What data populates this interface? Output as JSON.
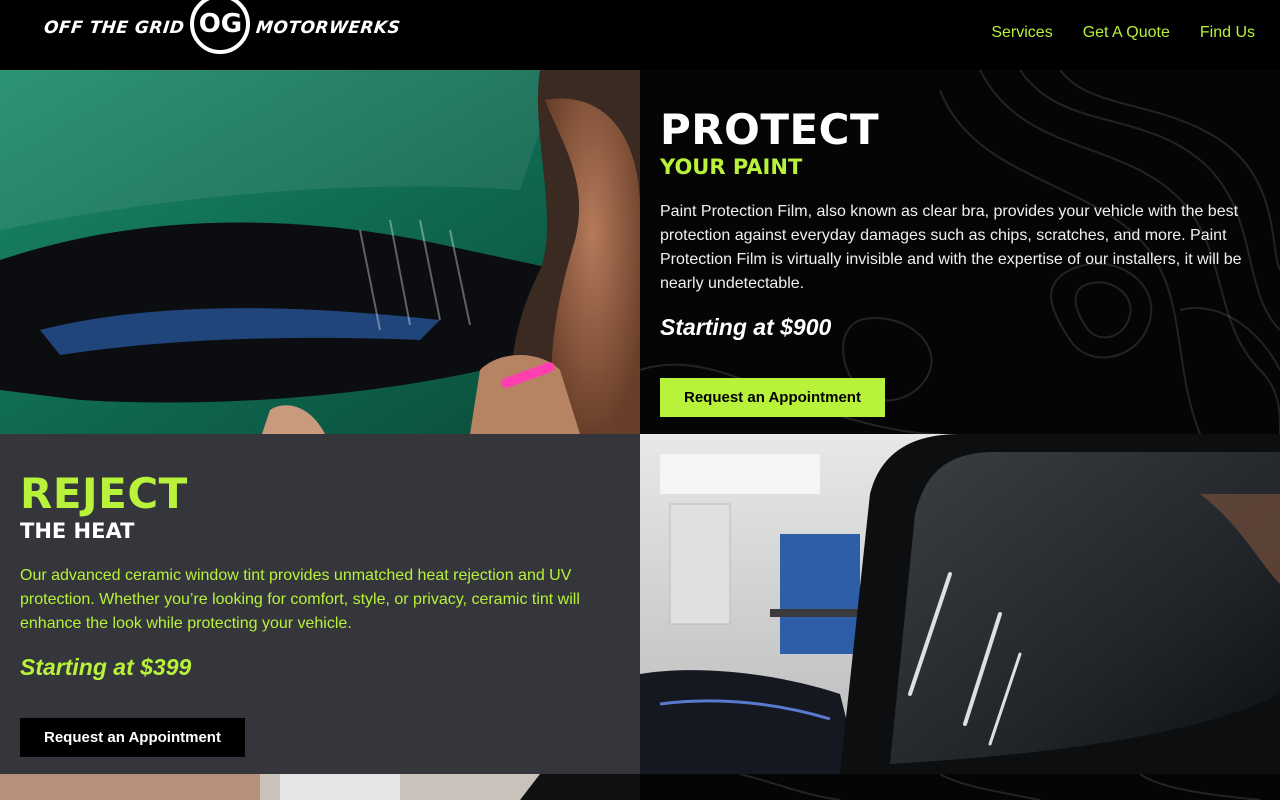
{
  "header": {
    "logo": {
      "left_text": "OFF THE GRID",
      "badge_text": "OG",
      "right_text": "MOTORWERKS"
    },
    "nav": [
      {
        "label": "Services"
      },
      {
        "label": "Get A Quote"
      },
      {
        "label": "Find Us"
      }
    ]
  },
  "sections": {
    "ppf": {
      "heading": "PROTECT",
      "subheading": "YOUR PAINT",
      "description": "Paint Protection Film, also known as clear bra, provides your vehicle with the best protection against everyday damages such as chips, scratches, and more. Paint Protection Film is virtually invisible and with the expertise of our installers, it will be nearly undetectable.",
      "price": "Starting at $900",
      "button_label": "Request an Appointment"
    },
    "tint": {
      "heading": "REJECT",
      "subheading": "THE HEAT",
      "description": "Our advanced ceramic window tint provides unmatched heat rejection and UV protection. Whether you’re looking for comfort, style, or privacy, ceramic tint will enhance the look while protecting your vehicle.",
      "price": "Starting at $399",
      "button_label": "Request an Appointment"
    }
  },
  "colors": {
    "accent": "#b8f23a",
    "black": "#000000",
    "panel_gray": "#35363b"
  }
}
